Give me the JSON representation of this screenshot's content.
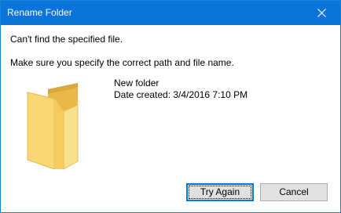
{
  "window": {
    "title": "Rename Folder",
    "close_icon": "close-icon",
    "accent_color": "#0a74da"
  },
  "message": {
    "line1": "Can't find the specified file.",
    "line2": "Make sure you specify the correct path and file name."
  },
  "item": {
    "icon": "folder-icon",
    "name": "New folder",
    "date_created": "Date created: 3/4/2016 7:10 PM"
  },
  "buttons": {
    "try_again_label": "Try Again",
    "cancel_label": "Cancel"
  }
}
